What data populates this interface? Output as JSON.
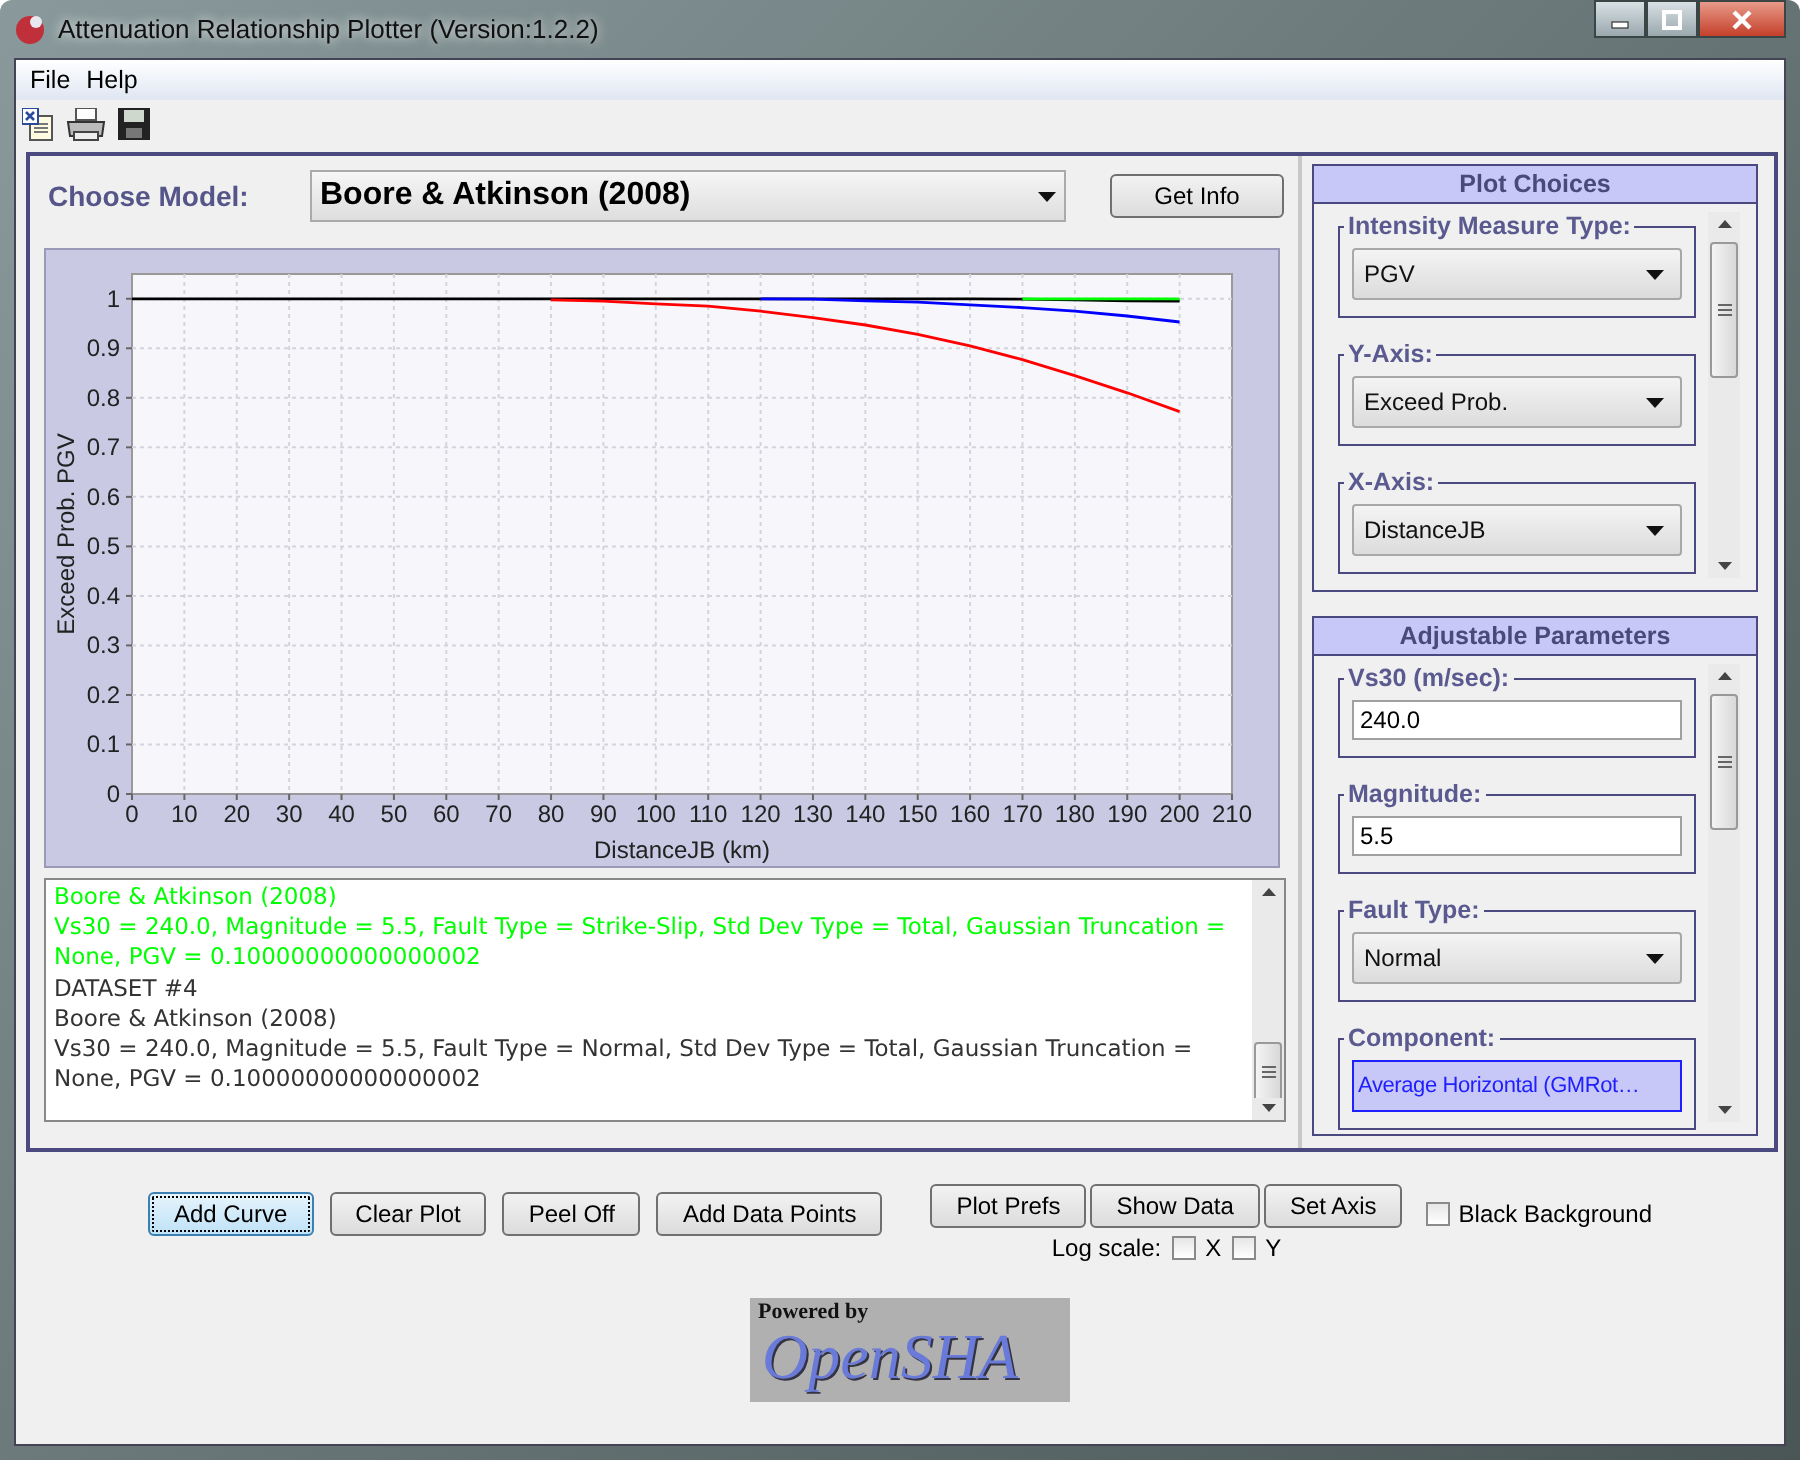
{
  "window": {
    "title": "Attenuation Relationship Plotter (Version:1.2.2)"
  },
  "menu": [
    {
      "label": "File"
    },
    {
      "label": "Help"
    }
  ],
  "model": {
    "label": "Choose Model:",
    "value": "Boore & Atkinson (2008)",
    "info_button": "Get Info"
  },
  "chart": {
    "chart_data": {
      "type": "line",
      "xlabel": "DistanceJB (km)",
      "ylabel": "Exceed Prob. PGV",
      "x": [
        0,
        10,
        20,
        30,
        40,
        50,
        60,
        70,
        80,
        90,
        100,
        110,
        120,
        130,
        140,
        150,
        160,
        170,
        180,
        190,
        200
      ],
      "series": [
        {
          "color": "#000000",
          "values": [
            1,
            1,
            1,
            1,
            1,
            1,
            1,
            1,
            1,
            1,
            1,
            1,
            1,
            1,
            1,
            1,
            1,
            0.999,
            0.998,
            0.996,
            0.995
          ]
        },
        {
          "color": "#ff0000",
          "values": [
            null,
            null,
            null,
            null,
            null,
            null,
            null,
            null,
            0.998,
            0.995,
            0.99,
            0.985,
            0.975,
            0.962,
            0.947,
            0.928,
            0.905,
            0.877,
            0.845,
            0.81,
            0.772
          ]
        },
        {
          "color": "#0000ff",
          "values": [
            null,
            null,
            null,
            null,
            null,
            null,
            null,
            null,
            null,
            null,
            null,
            null,
            1,
            0.999,
            0.996,
            0.993,
            0.988,
            0.982,
            0.975,
            0.965,
            0.953
          ]
        },
        {
          "color": "#00ff00",
          "values": [
            null,
            null,
            null,
            null,
            null,
            null,
            null,
            null,
            null,
            null,
            null,
            null,
            null,
            null,
            null,
            null,
            null,
            1,
            1,
            1,
            1
          ]
        }
      ],
      "xlim": [
        0,
        210
      ],
      "ylim": [
        0,
        1.05
      ],
      "grid": true,
      "xticks": [
        0,
        10,
        20,
        30,
        40,
        50,
        60,
        70,
        80,
        90,
        100,
        110,
        120,
        130,
        140,
        150,
        160,
        170,
        180,
        190,
        200,
        210
      ],
      "yticks": [
        0,
        0.1,
        0.2,
        0.3,
        0.4,
        0.5,
        0.6,
        0.7,
        0.8,
        0.9,
        1
      ]
    }
  },
  "log": [
    {
      "text": "Boore & Atkinson (2008)",
      "color": "#00ff00"
    },
    {
      "text": "Vs30 = 240.0, Magnitude = 5.5, Fault Type = Strike-Slip, Std Dev Type = Total, Gaussian Truncation = None, PGV = 0.10000000000000002",
      "color": "#00ff00"
    },
    {
      "text": "DATASET #4",
      "color": "#333333"
    },
    {
      "text": "Boore & Atkinson (2008)",
      "color": "#333333"
    },
    {
      "text": "Vs30 = 240.0, Magnitude = 5.5, Fault Type = Normal, Std Dev Type = Total, Gaussian Truncation = None, PGV = 0.10000000000000002",
      "color": "#333333"
    }
  ],
  "plot_choices": {
    "title": "Plot Choices",
    "groups": [
      {
        "label": "Intensity Measure Type:",
        "kind": "dropdown",
        "value": "PGV",
        "focused": false
      },
      {
        "label": "Y-Axis:",
        "kind": "dropdown",
        "value": "Exceed Prob.",
        "focused": false
      },
      {
        "label": "X-Axis:",
        "kind": "dropdown",
        "value": "DistanceJB",
        "focused": false
      }
    ]
  },
  "adjustable_parameters": {
    "title": "Adjustable Parameters",
    "groups": [
      {
        "label": "Vs30 (m/sec):",
        "kind": "text",
        "value": "240.0",
        "focused": false
      },
      {
        "label": "Magnitude:",
        "kind": "text",
        "value": "5.5",
        "focused": false
      },
      {
        "label": "Fault Type:",
        "kind": "dropdown",
        "value": "Normal",
        "focused": false
      },
      {
        "label": "Component:",
        "kind": "dropdown",
        "value": "Average Horizontal (GMRot…",
        "focused": true
      }
    ]
  },
  "buttons": [
    {
      "label": "Add Curve",
      "focused": true
    },
    {
      "label": "Clear Plot",
      "focused": false
    },
    {
      "label": "Peel Off",
      "focused": false
    },
    {
      "label": "Add Data Points",
      "focused": false
    }
  ],
  "plot_buttons": [
    {
      "label": "Plot Prefs"
    },
    {
      "label": "Show Data"
    },
    {
      "label": "Set Axis"
    }
  ],
  "log_scale": {
    "label": "Log scale:",
    "options": [
      {
        "label": "X",
        "checked": false
      },
      {
        "label": "Y",
        "checked": false
      }
    ]
  },
  "black_background": {
    "label": "Black Background",
    "checked": false
  },
  "logo": {
    "caption": "Powered by",
    "wordmark": "OpenSHA"
  }
}
